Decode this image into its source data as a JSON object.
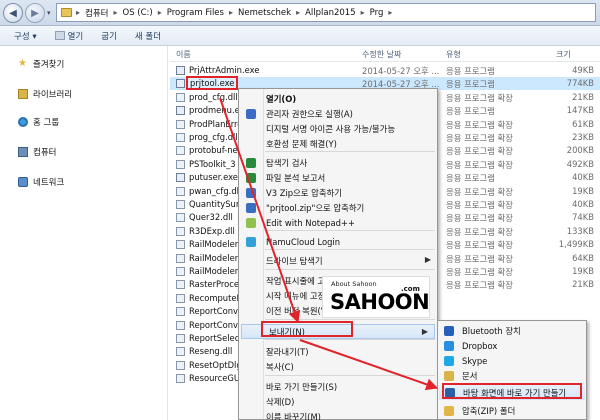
{
  "address": {
    "segments": [
      "컴퓨터",
      "OS (C:)",
      "Program Files",
      "Nemetschek",
      "Allplan2015",
      "Prg"
    ]
  },
  "toolbar": {
    "organize": "구성 ▾",
    "open": "열기",
    "share": "굽기",
    "newfolder": "새 폴더"
  },
  "nav": {
    "favorites": "즐겨찾기",
    "libraries": "라이브러리",
    "homegroup": "홈 그룹",
    "computer": "컴퓨터",
    "network": "네트워크"
  },
  "columns": {
    "name": "이름",
    "date": "수정한 날짜",
    "type": "유형",
    "size": "크기"
  },
  "files": [
    {
      "name": "PrjAttrAdmin.exe",
      "date": "2014-05-27 오후 ...",
      "type": "응용 프로그램",
      "size": "49KB"
    },
    {
      "name": "prjtool.exe",
      "date": "2014-05-27 오후 ...",
      "type": "응용 프로그램",
      "size": "774KB"
    },
    {
      "name": "prod_cfg.dll",
      "date": "",
      "type": "응용 프로그램 확장",
      "size": "21KB"
    },
    {
      "name": "prodmenu.exe",
      "date": "",
      "type": "응용 프로그램",
      "size": "147KB"
    },
    {
      "name": "ProdPlanError",
      "date": "",
      "type": "응용 프로그램 확장",
      "size": "61KB"
    },
    {
      "name": "prog_cfg.dll",
      "date": "",
      "type": "응용 프로그램 확장",
      "size": "23KB"
    },
    {
      "name": "protobuf-net",
      "date": "",
      "type": "응용 프로그램 확장",
      "size": "200KB"
    },
    {
      "name": "PSToolkit_3",
      "date": "",
      "type": "응용 프로그램 확장",
      "size": "492KB"
    },
    {
      "name": "putuser.exe",
      "date": "",
      "type": "응용 프로그램",
      "size": "40KB"
    },
    {
      "name": "pwan_cfg.dll",
      "date": "",
      "type": "응용 프로그램 확장",
      "size": "19KB"
    },
    {
      "name": "QuantitySum",
      "date": "",
      "type": "응용 프로그램 확장",
      "size": "40KB"
    },
    {
      "name": "Quer32.dll",
      "date": "",
      "type": "응용 프로그램 확장",
      "size": "74KB"
    },
    {
      "name": "R3DExp.dll",
      "date": "",
      "type": "응용 프로그램 확장",
      "size": "133KB"
    },
    {
      "name": "RailModeler.",
      "date": "",
      "type": "응용 프로그램 확장",
      "size": "1,499KB"
    },
    {
      "name": "RailModeler_",
      "date": "",
      "type": "응용 프로그램 확장",
      "size": "64KB"
    },
    {
      "name": "RailModeler_",
      "date": "",
      "type": "응용 프로그램 확장",
      "size": "19KB"
    },
    {
      "name": "RasterProces",
      "date": "",
      "type": "응용 프로그램 확장",
      "size": "21KB"
    },
    {
      "name": "RecomputeD",
      "date": "",
      "type": "",
      "size": ""
    },
    {
      "name": "ReportConve",
      "date": "",
      "type": "",
      "size": ""
    },
    {
      "name": "ReportConve",
      "date": "",
      "type": "",
      "size": ""
    },
    {
      "name": "ReportSelect",
      "date": "",
      "type": "",
      "size": ""
    },
    {
      "name": "Reseng.dll",
      "date": "",
      "type": "",
      "size": ""
    },
    {
      "name": "ResetOptDlg",
      "date": "",
      "type": "",
      "size": ""
    },
    {
      "name": "ResourceGUI",
      "date": "",
      "type": "",
      "size": ""
    }
  ],
  "context_menu": {
    "items": [
      {
        "label": "열기(O)",
        "bold": true,
        "icon": "none"
      },
      {
        "label": "관리자 권한으로 실행(A)",
        "icon": "shield-icon",
        "color": "#3d6bc4"
      },
      {
        "label": "디지털 서명 아이콘 사용 가능/불가능",
        "icon": "none"
      },
      {
        "label": "호환성 문제 해결(Y)",
        "icon": "none"
      },
      {
        "label": "탐색기 검사",
        "icon": "v3-icon",
        "color": "#2a8a3c"
      },
      {
        "label": "파일 분석 보고서",
        "icon": "v3-icon",
        "color": "#2a8a3c"
      },
      {
        "label": "V3 Zip으로 압축하기",
        "icon": "zip-icon",
        "color": "#3a6fbf"
      },
      {
        "label": "\"prjtool.zip\"으로 압축하기",
        "icon": "zip-icon",
        "color": "#3a6fbf"
      },
      {
        "label": "Edit with Notepad++",
        "icon": "notepad-icon",
        "color": "#8fc14c"
      },
      {
        "label": "NamuCloud Login",
        "icon": "cloud-icon",
        "color": "#35a0d8"
      },
      {
        "label": "드라이브 탐색기",
        "icon": "none",
        "arrow": true
      },
      {
        "label": "작업 표시줄에 고정",
        "icon": "none"
      },
      {
        "label": "시작 메뉴에 고정",
        "icon": "none"
      },
      {
        "label": "이전 버전 복원(V)",
        "icon": "none"
      },
      {
        "label": "보내기(N)",
        "icon": "none",
        "arrow": true
      },
      {
        "label": "잘라내기(T)",
        "icon": "none"
      },
      {
        "label": "복사(C)",
        "icon": "none"
      },
      {
        "label": "바로 가기 만들기(S)",
        "icon": "none"
      },
      {
        "label": "삭제(D)",
        "icon": "none"
      },
      {
        "label": "이름 바꾸기(M)",
        "icon": "none"
      }
    ]
  },
  "send_to": {
    "items": [
      {
        "label": "Bluetooth 장치",
        "icon": "bluetooth-icon",
        "color": "#2860b8"
      },
      {
        "label": "Dropbox",
        "icon": "dropbox-icon",
        "color": "#2a8fe0"
      },
      {
        "label": "Skype",
        "icon": "skype-icon",
        "color": "#1fa8e8"
      },
      {
        "label": "문서",
        "icon": "documents-icon",
        "color": "#d9b44a"
      },
      {
        "label": "바탕 화면에 바로 가기 만들기",
        "icon": "desktop-icon",
        "color": "#2d5ea8"
      },
      {
        "label": "압축(ZIP) 폴더",
        "icon": "zip-folder-icon",
        "color": "#e1b646"
      }
    ]
  },
  "watermark": {
    "small": "About Sahoon",
    "com": ".com",
    "big": "SAHOON"
  },
  "accent": "#e0242a"
}
